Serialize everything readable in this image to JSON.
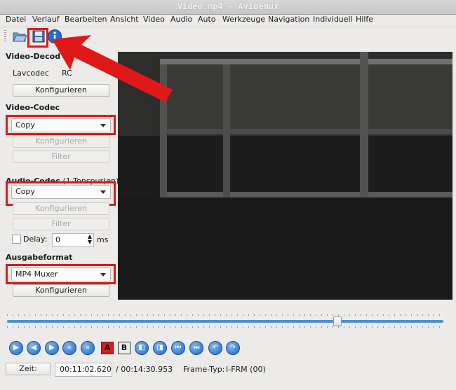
{
  "window": {
    "title": "Video.mp4 - Avidemux"
  },
  "menu": [
    "Datei",
    "Verlauf",
    "Bearbeiten",
    "Ansicht",
    "Video",
    "Audio",
    "Auto",
    "Werkzeuge",
    "Navigation",
    "Individuell",
    "Hilfe"
  ],
  "toolbar": {
    "icons": [
      "open-folder-icon",
      "save-disk-icon",
      "info-icon"
    ]
  },
  "video_decoder": {
    "heading": "Video-Decod",
    "decoder": "Lavcodec",
    "decoder_extra": "RC",
    "configure": "Konfigurieren"
  },
  "video_codec": {
    "heading": "Video-Codec",
    "selected": "Copy",
    "configure": "Konfigurieren",
    "filter": "Filter"
  },
  "audio_codec": {
    "heading": "Audio-Codec",
    "tracks": "(1 Tonspur(en))",
    "selected": "Copy",
    "configure": "Konfigurieren",
    "filter": "Filter",
    "delay_label": "Delay:",
    "delay_value": "0",
    "delay_unit": "ms"
  },
  "output_format": {
    "heading": "Ausgabeformat",
    "selected": "MP4 Muxer",
    "configure": "Konfigurieren"
  },
  "timeline": {
    "position": 0.756
  },
  "statusbar": {
    "time_button": "Zeit:",
    "current_time": "00:11:02.620",
    "total_time": "/ 00:14:30.953",
    "frame_type_label": "Frame-Typ:",
    "frame_type_value": "I-FRM (00)"
  },
  "colors": {
    "highlight": "#e01818",
    "accent": "#4a90d9"
  }
}
